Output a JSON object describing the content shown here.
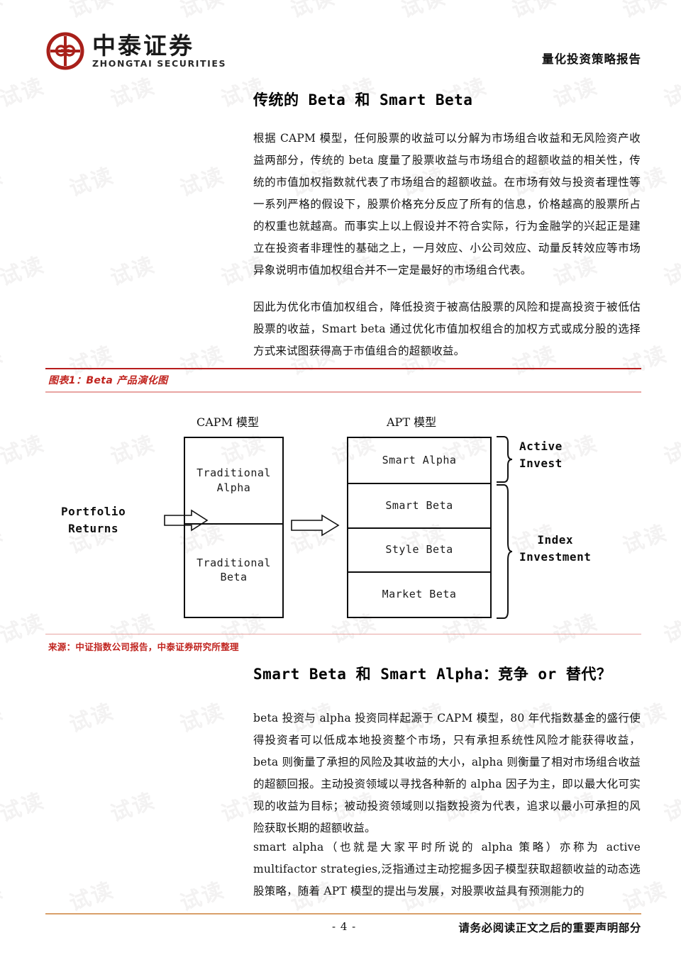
{
  "header": {
    "logo_cn": "中泰证券",
    "logo_en": "ZHONGTAI SECURITIES",
    "logo_color": "#A8201A",
    "report_type": "量化投资策略报告"
  },
  "watermark": {
    "text": "试读",
    "color": "rgba(120,110,105,0.085)"
  },
  "sections": [
    {
      "heading": "传统的 Beta 和 Smart Beta",
      "paragraphs": [
        "根据 CAPM 模型，任何股票的收益可以分解为市场组合收益和无风险资产收益两部分，传统的 beta 度量了股票收益与市场组合的超额收益的相关性，传统的市值加权指数就代表了市场组合的超额收益。在市场有效与投资者理性等一系列严格的假设下，股票价格充分反应了所有的信息，价格越高的股票所占的权重也就越高。而事实上以上假设并不符合实际，行为金融学的兴起正是建立在投资者非理性的基础之上，一月效应、小公司效应、动量反转效应等市场异象说明市值加权组合并不一定是最好的市场组合代表。",
        "因此为优化市值加权组合，降低投资于被高估股票的风险和提高投资于被低估股票的收益，Smart beta 通过优化市值加权组合的加权方式或成分股的选择方式来试图获得高于市值组合的超额收益。"
      ]
    },
    {
      "heading": "Smart Beta 和 Smart Alpha：竞争 or 替代？",
      "paragraphs": [
        "beta 投资与 alpha 投资同样起源于 CAPM 模型，80 年代指数基金的盛行使得投资者可以低成本地投资整个市场，只有承担系统性风险才能获得收益，beta 则衡量了承担的风险及其收益的大小，alpha 则衡量了相对市场组合收益的超额回报。主动投资领域以寻找各种新的 alpha 因子为主，即以最大化可实现的收益为目标；被动投资领域则以指数投资为代表，追求以最小可承担的风险获取长期的超额收益。",
        "smart alpha（也就是大家平时所说的 alpha 策略）亦称为 active multifactor strategies,泛指通过主动挖掘多因子模型获取超额收益的动态选股策略，随着 APT 模型的提出与发展，对股票收益具有预测能力的"
      ]
    }
  ],
  "figure": {
    "caption": "图表1：Beta 产品演化图",
    "caption_color": "#C0241F",
    "rule_top_color": "#B71C1C",
    "rule_light_color": "#E8A5A2",
    "source": "来源：中证指数公司报告，中泰证券研究所整理",
    "diagram": {
      "left_model_label": "CAPM 模型",
      "right_model_label": "APT 模型",
      "input_label_line1": "Portfolio",
      "input_label_line2": "Returns",
      "left_cells": [
        "Traditional\nAlpha",
        "Traditional\nBeta"
      ],
      "left_cells_flat": [
        "Traditional Alpha",
        "Traditional Beta"
      ],
      "right_cells": [
        "Smart Alpha",
        "Smart Beta",
        "Style Beta",
        "Market Beta"
      ],
      "group_active_line1": "Active",
      "group_active_line2": "Invest",
      "group_index_line1": "Index",
      "group_index_line2": "Investment"
    }
  },
  "footer": {
    "page_number": "- 4 -",
    "notice": "请务必阅读正文之后的重要声明部分",
    "rule_color": "#D9A06A"
  }
}
